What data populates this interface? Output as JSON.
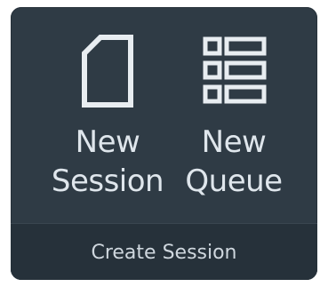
{
  "group": {
    "caption": "Create Session"
  },
  "buttons": [
    {
      "label": "New\nSession",
      "icon": "new-document-icon"
    },
    {
      "label": "New\nQueue",
      "icon": "queue-list-icon"
    }
  ],
  "colors": {
    "panel_bg": "#2f3b45",
    "footer_bg": "#26313a",
    "text": "#dfe6ec"
  }
}
